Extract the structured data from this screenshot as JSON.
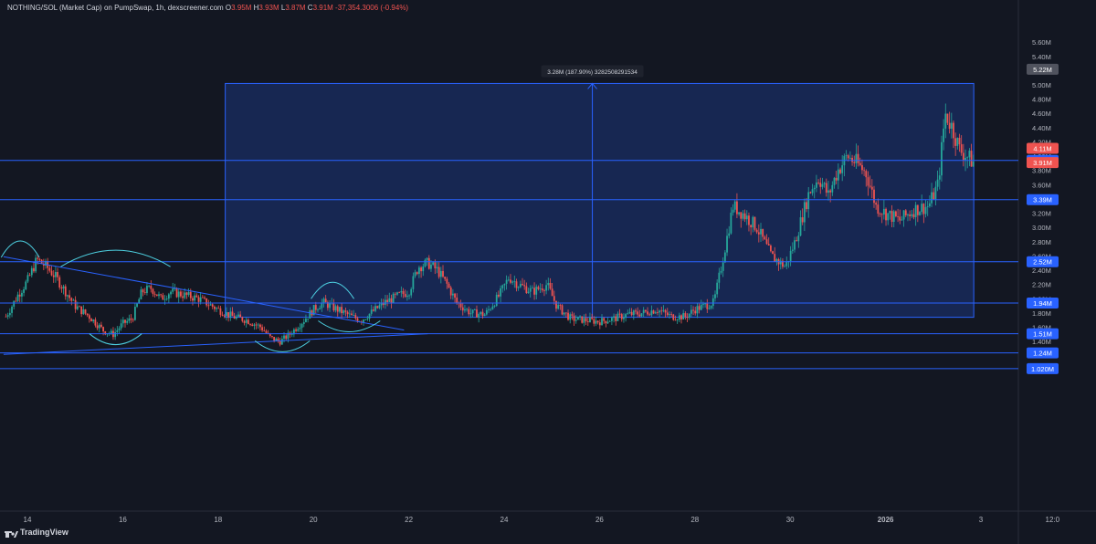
{
  "header": {
    "symbol": "NOTHING/SOL (Market Cap) on PumpSwap, 1h, dexscreener.com",
    "o_label": "O",
    "o": "3.95M",
    "h_label": "H",
    "h": "3.93M",
    "l_label": "L",
    "l": "3.87M",
    "c_label": "C",
    "c": "3.91M",
    "change": "-37,354.3006 (-0.94%)"
  },
  "brand": {
    "name": "TradingView"
  },
  "colors": {
    "background": "#131722",
    "up": "#26a69a",
    "down": "#ef5350",
    "drawing": "#2962ff",
    "arc": "#4dd0e1"
  },
  "chart_data": {
    "type": "candlestick",
    "interval": "1h",
    "y_scale": "linear",
    "ylim": [
      0.95,
      5.75
    ],
    "y_ticks": [
      "1.40M",
      "1.60M",
      "1.80M",
      "2.00M",
      "2.20M",
      "2.40M",
      "2.60M",
      "2.80M",
      "3.00M",
      "3.20M",
      "3.40M",
      "3.60M",
      "3.80M",
      "4.00M",
      "4.20M",
      "4.40M",
      "4.60M",
      "4.80M",
      "5.00M",
      "5.20M",
      "5.40M",
      "5.60M"
    ],
    "y_tick_values": [
      1.4,
      1.6,
      1.8,
      2.0,
      2.2,
      2.4,
      2.6,
      2.8,
      3.0,
      3.2,
      3.4,
      3.6,
      3.8,
      4.0,
      4.2,
      4.4,
      4.6,
      4.8,
      5.0,
      5.2,
      5.4,
      5.6
    ],
    "x_range_days": [
      13.5,
      3.3
    ],
    "x_ticks": [
      {
        "label": "14",
        "day": 14
      },
      {
        "label": "16",
        "day": 16
      },
      {
        "label": "18",
        "day": 18
      },
      {
        "label": "20",
        "day": 20
      },
      {
        "label": "22",
        "day": 22
      },
      {
        "label": "24",
        "day": 24
      },
      {
        "label": "26",
        "day": 26
      },
      {
        "label": "28",
        "day": 28
      },
      {
        "label": "30",
        "day": 30
      },
      {
        "label": "2026",
        "day": 32
      },
      {
        "label": "3",
        "day": 34
      },
      {
        "label": "12:0",
        "day": 35.5
      }
    ],
    "price_path": [
      [
        13.55,
        1.75
      ],
      [
        13.8,
        2.05
      ],
      [
        14.0,
        2.25
      ],
      [
        14.2,
        2.55
      ],
      [
        14.4,
        2.45
      ],
      [
        14.6,
        2.3
      ],
      [
        14.8,
        2.1
      ],
      [
        15.0,
        1.9
      ],
      [
        15.3,
        1.75
      ],
      [
        15.6,
        1.55
      ],
      [
        15.8,
        1.5
      ],
      [
        16.0,
        1.65
      ],
      [
        16.2,
        1.72
      ],
      [
        16.4,
        2.1
      ],
      [
        16.6,
        2.15
      ],
      [
        16.8,
        2.0
      ],
      [
        17.0,
        2.1
      ],
      [
        17.3,
        2.05
      ],
      [
        17.6,
        2.0
      ],
      [
        18.0,
        1.85
      ],
      [
        18.3,
        1.75
      ],
      [
        18.6,
        1.7
      ],
      [
        18.9,
        1.6
      ],
      [
        19.1,
        1.45
      ],
      [
        19.3,
        1.4
      ],
      [
        19.5,
        1.5
      ],
      [
        19.8,
        1.7
      ],
      [
        20.0,
        1.85
      ],
      [
        20.2,
        1.95
      ],
      [
        20.5,
        1.85
      ],
      [
        20.8,
        1.75
      ],
      [
        21.0,
        1.7
      ],
      [
        21.2,
        1.8
      ],
      [
        21.5,
        1.95
      ],
      [
        21.8,
        2.05
      ],
      [
        22.0,
        2.1
      ],
      [
        22.2,
        2.45
      ],
      [
        22.4,
        2.5
      ],
      [
        22.6,
        2.4
      ],
      [
        22.8,
        2.2
      ],
      [
        23.0,
        1.95
      ],
      [
        23.3,
        1.8
      ],
      [
        23.6,
        1.78
      ],
      [
        23.9,
        2.05
      ],
      [
        24.1,
        2.3
      ],
      [
        24.3,
        2.2
      ],
      [
        24.6,
        2.1
      ],
      [
        24.9,
        2.2
      ],
      [
        25.1,
        1.9
      ],
      [
        25.4,
        1.72
      ],
      [
        25.7,
        1.7
      ],
      [
        26.0,
        1.68
      ],
      [
        26.3,
        1.72
      ],
      [
        26.6,
        1.78
      ],
      [
        26.9,
        1.8
      ],
      [
        27.2,
        1.85
      ],
      [
        27.5,
        1.75
      ],
      [
        27.8,
        1.75
      ],
      [
        28.0,
        1.85
      ],
      [
        28.2,
        1.9
      ],
      [
        28.4,
        1.95
      ],
      [
        28.6,
        2.6
      ],
      [
        28.8,
        3.3
      ],
      [
        29.0,
        3.2
      ],
      [
        29.3,
        3.0
      ],
      [
        29.6,
        2.6
      ],
      [
        29.9,
        2.45
      ],
      [
        30.1,
        2.8
      ],
      [
        30.4,
        3.5
      ],
      [
        30.6,
        3.7
      ],
      [
        30.8,
        3.45
      ],
      [
        31.0,
        3.8
      ],
      [
        31.2,
        4.0
      ],
      [
        31.4,
        3.9
      ],
      [
        31.6,
        3.75
      ],
      [
        31.8,
        3.3
      ],
      [
        32.0,
        3.2
      ],
      [
        32.3,
        3.1
      ],
      [
        32.6,
        3.25
      ],
      [
        32.9,
        3.3
      ],
      [
        33.1,
        3.6
      ],
      [
        33.25,
        4.6
      ],
      [
        33.4,
        4.4
      ],
      [
        33.55,
        4.1
      ],
      [
        33.7,
        4.0
      ],
      [
        33.85,
        3.91
      ]
    ],
    "horizontal_levels": [
      {
        "value": 3.94,
        "label": "3.94M"
      },
      {
        "value": 3.39,
        "label": "3.39M"
      },
      {
        "value": 2.52,
        "label": "2.52M"
      },
      {
        "value": 1.94,
        "label": "1.94M"
      },
      {
        "value": 1.51,
        "label": "1.51M"
      },
      {
        "value": 1.24,
        "label": "1.24M"
      },
      {
        "value": 1.02,
        "label": "1.020M"
      }
    ],
    "price_badges": [
      {
        "value": 5.22,
        "label": "5.22M",
        "color": "#50535e"
      },
      {
        "value": 4.11,
        "label": "4.11M",
        "color": "#ef5350"
      },
      {
        "value": 3.91,
        "label": "3.91M",
        "color": "#ef5350"
      }
    ],
    "measure_box": {
      "x0_day": 18.15,
      "x1_day": 33.85,
      "y0": 1.74,
      "y1": 5.02,
      "label": "3.28M (187.90%) 3282508291534",
      "arrow_day": 25.85
    },
    "trendlines": [
      {
        "x0_day": 13.5,
        "y0": 2.59,
        "x1_day": 21.9,
        "y1": 1.56
      },
      {
        "x0_day": 13.5,
        "y0": 1.22,
        "x1_day": 22.4,
        "y1": 1.51
      }
    ],
    "arc_notes": [
      {
        "day": 15.85,
        "y": 1.51,
        "w_days": 1.1,
        "dir": "down"
      },
      {
        "day": 15.85,
        "y": 2.45,
        "w_days": 2.3,
        "dir": "up"
      },
      {
        "day": 19.35,
        "y": 1.41,
        "w_days": 1.15,
        "dir": "down"
      },
      {
        "day": 20.4,
        "y": 2.0,
        "w_days": 0.9,
        "dir": "up"
      },
      {
        "day": 20.75,
        "y": 1.69,
        "w_days": 1.3,
        "dir": "down"
      },
      {
        "day": 13.85,
        "y": 2.58,
        "w_days": 0.8,
        "dir": "up"
      }
    ]
  }
}
